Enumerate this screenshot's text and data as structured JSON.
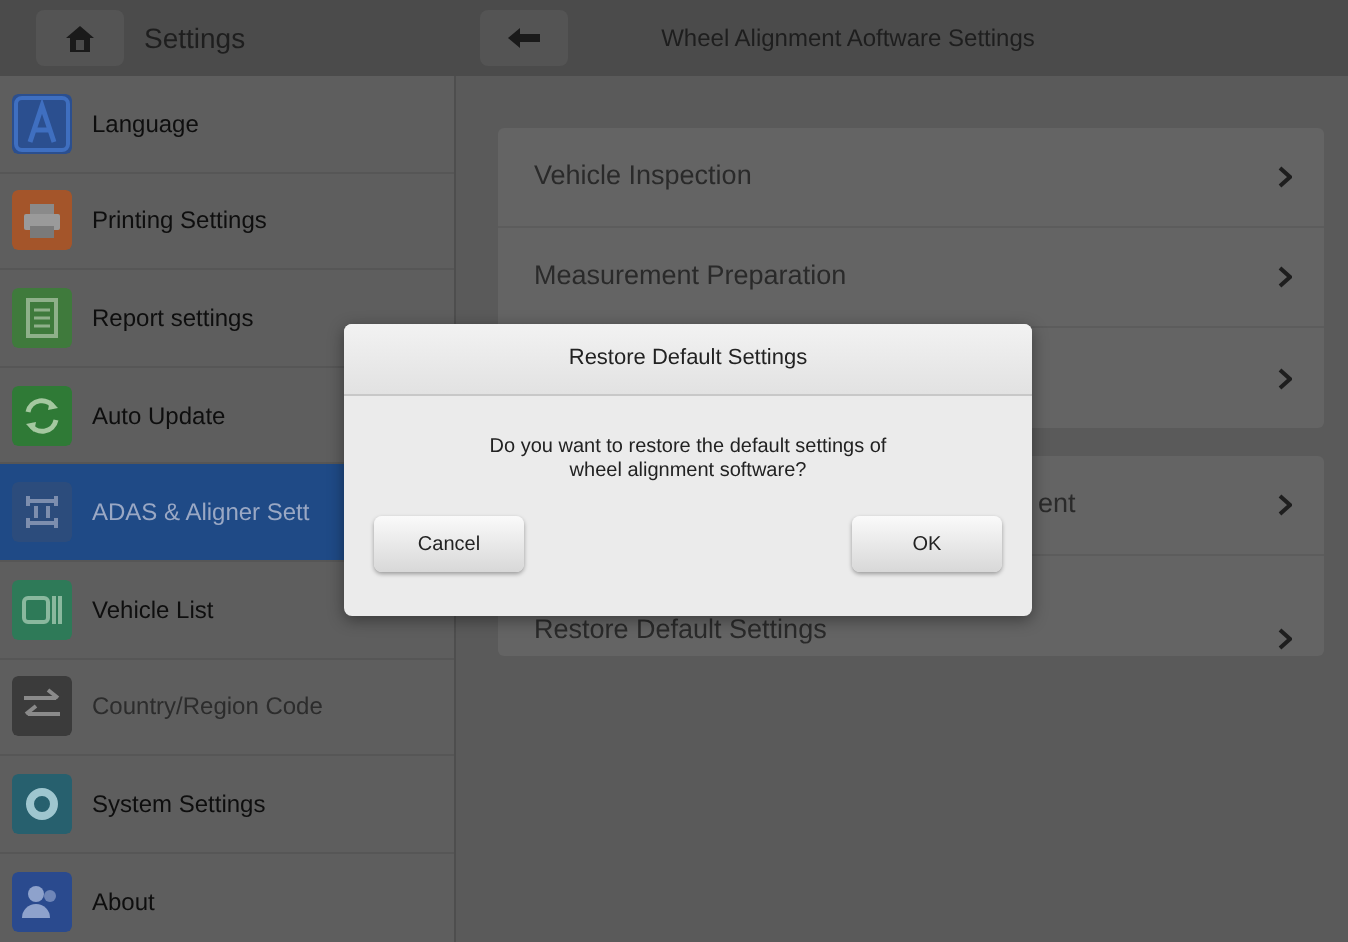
{
  "header": {
    "left_title": "Settings",
    "right_title": "Wheel Alignment Aoftware Settings"
  },
  "sidebar": {
    "items": [
      {
        "label": "Language",
        "color": "#2b4f8f",
        "selected": false,
        "disabled": false
      },
      {
        "label": "Printing Settings",
        "color": "#a4552a",
        "selected": false,
        "disabled": false
      },
      {
        "label": "Report settings",
        "color": "#3f7a3c",
        "selected": false,
        "disabled": false
      },
      {
        "label": "Auto Update",
        "color": "#2f7a36",
        "selected": false,
        "disabled": false
      },
      {
        "label": "ADAS & Aligner Sett",
        "color": "#2c4c7c",
        "selected": true,
        "disabled": false
      },
      {
        "label": "Vehicle List",
        "color": "#2e7a58",
        "selected": false,
        "disabled": false
      },
      {
        "label": "Country/Region Code",
        "color": "#3b3b3b",
        "selected": false,
        "disabled": true
      },
      {
        "label": "System Settings",
        "color": "#27606e",
        "selected": false,
        "disabled": false
      },
      {
        "label": "About",
        "color": "#2a4a8e",
        "selected": false,
        "disabled": false
      }
    ]
  },
  "groups": [
    {
      "rows": [
        {
          "label": "Vehicle Inspection"
        },
        {
          "label": "Measurement Preparation"
        },
        {}
      ]
    },
    {
      "rows": [
        {
          "label": "ent"
        },
        {
          "label": "Restore Default Settings"
        }
      ]
    }
  ],
  "dialog": {
    "title": "Restore Default Settings",
    "message": "Do you want to restore the default settings of wheel alignment software?",
    "buttons": [
      "Cancel",
      "OK"
    ]
  }
}
